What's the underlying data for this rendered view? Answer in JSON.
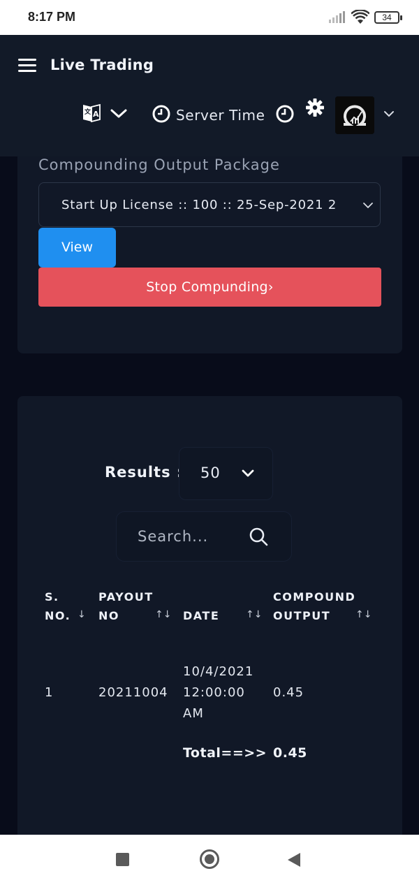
{
  "status_bar": {
    "time": "8:17 PM",
    "battery": "34",
    "icons": [
      "signal-icon",
      "wifi-icon",
      "battery-icon"
    ]
  },
  "header": {
    "title": "Live Trading",
    "server_time_label": "Server Time",
    "icons": [
      "hamburger-menu-icon",
      "translate-icon",
      "clock-icon",
      "settings-gear-icon",
      "avatar-logo"
    ]
  },
  "compounding": {
    "label": "Compounding Output Package",
    "selected_package": "Start Up License :: 100 :: 25-Sep-2021 2",
    "view_button": "View",
    "stop_button": "Stop Compunding›"
  },
  "results": {
    "label": "Results :",
    "page_size": "50"
  },
  "search": {
    "placeholder": "Search..."
  },
  "table": {
    "columns": [
      {
        "line1": "S.",
        "line2": "NO.",
        "sort": "↓"
      },
      {
        "line1": "PAYOUT",
        "line2": "NO",
        "sort": "↑↓"
      },
      {
        "line1": "",
        "line2": "DATE",
        "sort": "↑↓"
      },
      {
        "line1": "COMPOUND",
        "line2": "OUTPUT",
        "sort": "↑↓"
      }
    ],
    "rows": [
      {
        "sno": "1",
        "payout_no": "20211004",
        "date_line1": "10/4/2021",
        "date_line2": "12:00:00",
        "date_line3": "AM",
        "output": "0.45"
      }
    ],
    "total_label": "Total==>>",
    "total_value": "0.45"
  },
  "colors": {
    "background": "#080c1a",
    "card": "#111827",
    "primary": "#1f8ff0",
    "danger": "#e5525b"
  }
}
